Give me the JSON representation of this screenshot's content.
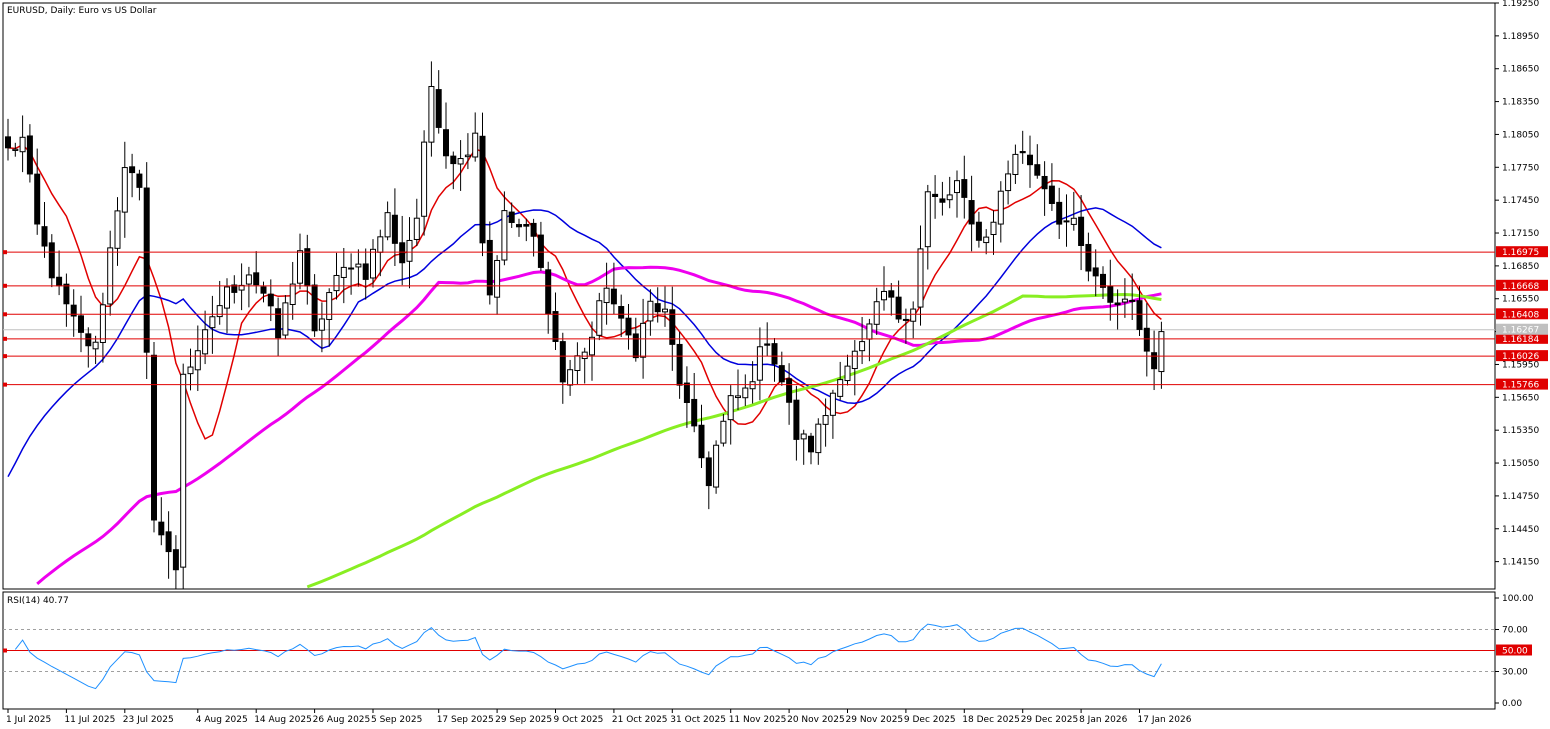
{
  "chart_data": [
    {
      "type": "candlestick",
      "title": "EURUSD, Daily:  Euro vs US Dollar",
      "ylim": [
        1.139,
        1.1925
      ],
      "y_ticks": [
        "1.19250",
        "1.18950",
        "1.18650",
        "1.18350",
        "1.18050",
        "1.17750",
        "1.17450",
        "1.17150",
        "1.16850",
        "1.16550",
        "1.16250",
        "1.15950",
        "1.15650",
        "1.15350",
        "1.15050",
        "1.14750",
        "1.14450",
        "1.14150"
      ],
      "current_price": "1.16267",
      "x_ticks": [
        {
          "i": 0,
          "label": "1 Jul 2025"
        },
        {
          "i": 8,
          "label": "11 Jul 2025"
        },
        {
          "i": 16,
          "label": "23 Jul 2025"
        },
        {
          "i": 26,
          "label": "4 Aug 2025"
        },
        {
          "i": 34,
          "label": "14 Aug 2025"
        },
        {
          "i": 42,
          "label": "26 Aug 2025"
        },
        {
          "i": 50,
          "label": "5 Sep 2025"
        },
        {
          "i": 59,
          "label": "17 Sep 2025"
        },
        {
          "i": 67,
          "label": "29 Sep 2025"
        },
        {
          "i": 75,
          "label": "9 Oct 2025"
        },
        {
          "i": 83,
          "label": "21 Oct 2025"
        },
        {
          "i": 91,
          "label": "31 Oct 2025"
        },
        {
          "i": 99,
          "label": "11 Nov 2025"
        },
        {
          "i": 107,
          "label": "20 Nov 2025"
        },
        {
          "i": 115,
          "label": "29 Nov 2025"
        },
        {
          "i": 123,
          "label": "9 Dec 2025"
        },
        {
          "i": 131,
          "label": "18 Dec 2025"
        },
        {
          "i": 139,
          "label": "29 Dec 2025"
        },
        {
          "i": 147,
          "label": "8 Jan 2026"
        },
        {
          "i": 155,
          "label": "17 Jan 2026"
        }
      ],
      "levels": [
        {
          "value": 1.16975,
          "label": "1.16975",
          "color": "#e00000"
        },
        {
          "value": 1.16668,
          "label": "1.16668",
          "color": "#e00000"
        },
        {
          "value": 1.16408,
          "label": "1.16408",
          "color": "#e00000"
        },
        {
          "value": 1.16184,
          "label": "1.16184",
          "color": "#e00000"
        },
        {
          "value": 1.16026,
          "label": "1.16026",
          "color": "#e00000"
        },
        {
          "value": 1.15766,
          "label": "1.15766",
          "color": "#e00000"
        }
      ],
      "anchors": [
        [
          0,
          1.179
        ],
        [
          2,
          1.18
        ],
        [
          4,
          1.172
        ],
        [
          7,
          1.166
        ],
        [
          10,
          1.162
        ],
        [
          12,
          1.161
        ],
        [
          14,
          1.17
        ],
        [
          16,
          1.178
        ],
        [
          18,
          1.175
        ],
        [
          19,
          1.16
        ],
        [
          20,
          1.146
        ],
        [
          21,
          1.144
        ],
        [
          22,
          1.142
        ],
        [
          23,
          1.141
        ],
        [
          24,
          1.159
        ],
        [
          26,
          1.16
        ],
        [
          28,
          1.164
        ],
        [
          30,
          1.166
        ],
        [
          33,
          1.168
        ],
        [
          35,
          1.166
        ],
        [
          37,
          1.162
        ],
        [
          40,
          1.17
        ],
        [
          42,
          1.162
        ],
        [
          44,
          1.166
        ],
        [
          47,
          1.169
        ],
        [
          49,
          1.168
        ],
        [
          52,
          1.173
        ],
        [
          54,
          1.169
        ],
        [
          56,
          1.173
        ],
        [
          58,
          1.185
        ],
        [
          60,
          1.179
        ],
        [
          62,
          1.178
        ],
        [
          64,
          1.181
        ],
        [
          65,
          1.171
        ],
        [
          66,
          1.166
        ],
        [
          68,
          1.173
        ],
        [
          70,
          1.172
        ],
        [
          72,
          1.171
        ],
        [
          74,
          1.165
        ],
        [
          76,
          1.158
        ],
        [
          78,
          1.16
        ],
        [
          80,
          1.162
        ],
        [
          82,
          1.167
        ],
        [
          84,
          1.163
        ],
        [
          86,
          1.161
        ],
        [
          88,
          1.165
        ],
        [
          90,
          1.164
        ],
        [
          92,
          1.158
        ],
        [
          94,
          1.153
        ],
        [
          96,
          1.149
        ],
        [
          97,
          1.152
        ],
        [
          99,
          1.156
        ],
        [
          101,
          1.157
        ],
        [
          104,
          1.162
        ],
        [
          106,
          1.158
        ],
        [
          108,
          1.153
        ],
        [
          110,
          1.152
        ],
        [
          112,
          1.155
        ],
        [
          114,
          1.159
        ],
        [
          117,
          1.161
        ],
        [
          120,
          1.166
        ],
        [
          122,
          1.164
        ],
        [
          124,
          1.165
        ],
        [
          126,
          1.175
        ],
        [
          128,
          1.174
        ],
        [
          130,
          1.176
        ],
        [
          132,
          1.172
        ],
        [
          134,
          1.171
        ],
        [
          136,
          1.175
        ],
        [
          138,
          1.179
        ],
        [
          140,
          1.178
        ],
        [
          142,
          1.176
        ],
        [
          144,
          1.173
        ],
        [
          146,
          1.172
        ],
        [
          148,
          1.168
        ],
        [
          150,
          1.166
        ],
        [
          152,
          1.165
        ],
        [
          154,
          1.166
        ],
        [
          155,
          1.162
        ],
        [
          157,
          1.16
        ],
        [
          158,
          1.1625
        ]
      ],
      "series": [
        {
          "name": "",
          "period": 9,
          "color": "#e00000",
          "width": 1.5
        },
        {
          "name": "",
          "period": 25,
          "color": "#0000dd",
          "width": 1.5
        },
        {
          "name": "",
          "period": 60,
          "color": "#ee00ee",
          "width": 3
        },
        {
          "name": "",
          "period": 140,
          "color": "#88ee22",
          "width": 3
        }
      ]
    },
    {
      "type": "line",
      "title": "RSI(14) 40.77",
      "ylim": [
        0,
        100
      ],
      "y_ticks": [
        "100.00",
        "70.00",
        "30.00",
        "0.00"
      ],
      "levels": [
        {
          "value": 50,
          "label": "50.00",
          "color": "#e00000"
        }
      ],
      "dotted_levels": [
        70,
        30
      ],
      "series_color": "#1e90ff"
    }
  ]
}
